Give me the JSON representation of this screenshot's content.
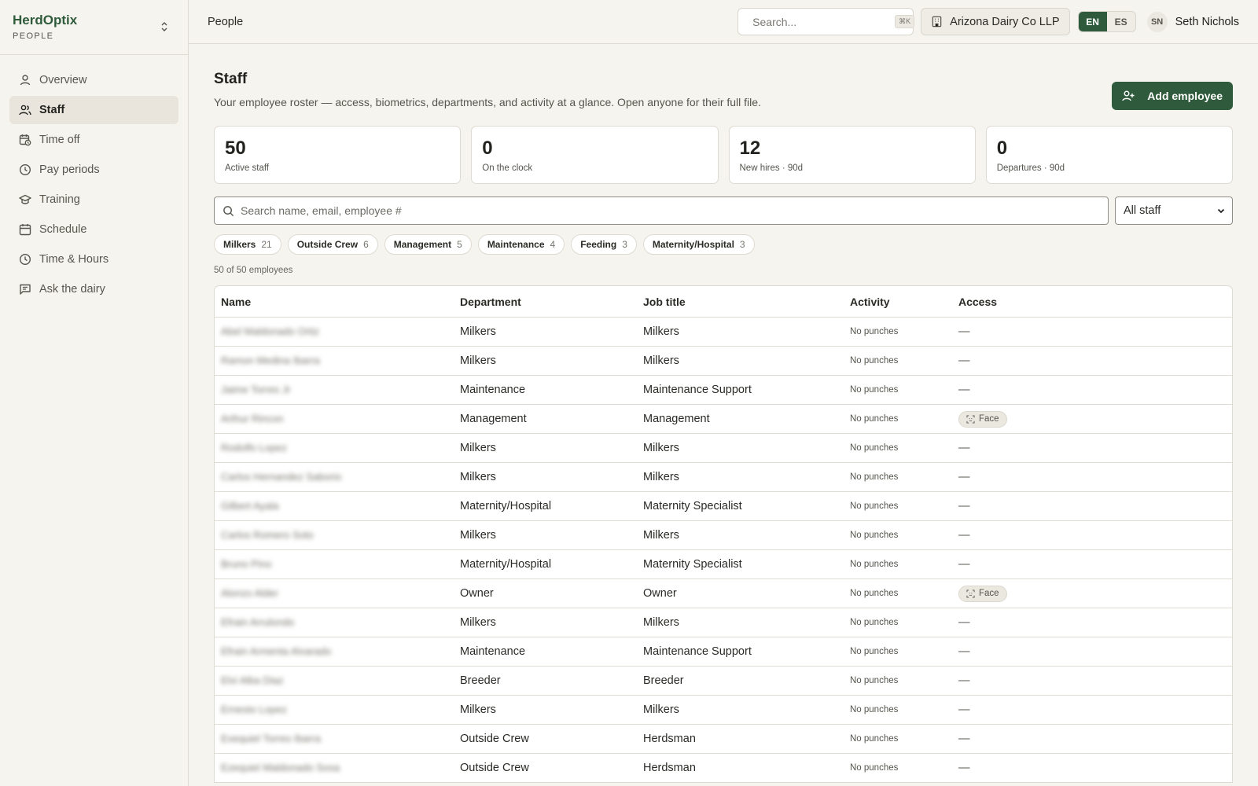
{
  "brand": {
    "name": "HerdOptix",
    "section": "PEOPLE"
  },
  "nav": [
    {
      "label": "Overview",
      "icon": "user-icon"
    },
    {
      "label": "Staff",
      "icon": "users-icon",
      "active": true
    },
    {
      "label": "Time off",
      "icon": "calendar-clock-icon"
    },
    {
      "label": "Pay periods",
      "icon": "clock-icon"
    },
    {
      "label": "Training",
      "icon": "graduation-cap-icon"
    },
    {
      "label": "Schedule",
      "icon": "calendar-icon"
    },
    {
      "label": "Time & Hours",
      "icon": "clock-icon"
    },
    {
      "label": "Ask the dairy",
      "icon": "message-icon"
    }
  ],
  "topbar": {
    "breadcrumb": "People",
    "search_placeholder": "Search...",
    "search_shortcut": "⌘K",
    "org_name": "Arizona Dairy Co LLP",
    "lang_en": "EN",
    "lang_es": "ES",
    "user_initials": "SN",
    "user_name": "Seth Nichols"
  },
  "page": {
    "title": "Staff",
    "subtitle": "Your employee roster — access, biometrics, departments, and activity at a glance. Open anyone for their full file.",
    "add_button": "Add employee"
  },
  "stats": [
    {
      "value": "50",
      "label": "Active staff"
    },
    {
      "value": "0",
      "label": "On the clock"
    },
    {
      "value": "12",
      "label": "New hires · 90d"
    },
    {
      "value": "0",
      "label": "Departures · 90d"
    }
  ],
  "filters": {
    "search_placeholder": "Search name, email, employee #",
    "select_value": "All staff"
  },
  "chips": [
    {
      "label": "Milkers",
      "count": "21"
    },
    {
      "label": "Outside Crew",
      "count": "6"
    },
    {
      "label": "Management",
      "count": "5"
    },
    {
      "label": "Maintenance",
      "count": "4"
    },
    {
      "label": "Feeding",
      "count": "3"
    },
    {
      "label": "Maternity/Hospital",
      "count": "3"
    }
  ],
  "result_count": "50 of 50 employees",
  "table": {
    "headers": {
      "name": "Name",
      "department": "Department",
      "job_title": "Job title",
      "activity": "Activity",
      "access": "Access"
    },
    "rows": [
      {
        "name": "Abel Maldonado Ortiz",
        "department": "Milkers",
        "job_title": "Milkers",
        "activity": "No punches",
        "access": "—"
      },
      {
        "name": "Ramon Medina Ibarra",
        "department": "Milkers",
        "job_title": "Milkers",
        "activity": "No punches",
        "access": "—"
      },
      {
        "name": "Jaime Torres Jr",
        "department": "Maintenance",
        "job_title": "Maintenance Support",
        "activity": "No punches",
        "access": "—"
      },
      {
        "name": "Arthur Rincon",
        "department": "Management",
        "job_title": "Management",
        "activity": "No punches",
        "access": "Face"
      },
      {
        "name": "Rodolfo Lopez",
        "department": "Milkers",
        "job_title": "Milkers",
        "activity": "No punches",
        "access": "—"
      },
      {
        "name": "Carlos Hernandez Saborio",
        "department": "Milkers",
        "job_title": "Milkers",
        "activity": "No punches",
        "access": "—"
      },
      {
        "name": "Gilbert Ayala",
        "department": "Maternity/Hospital",
        "job_title": "Maternity Specialist",
        "activity": "No punches",
        "access": "—"
      },
      {
        "name": "Carlos Romero Soto",
        "department": "Milkers",
        "job_title": "Milkers",
        "activity": "No punches",
        "access": "—"
      },
      {
        "name": "Bruno Pino",
        "department": "Maternity/Hospital",
        "job_title": "Maternity Specialist",
        "activity": "No punches",
        "access": "—"
      },
      {
        "name": "Alonzo Alder",
        "department": "Owner",
        "job_title": "Owner",
        "activity": "No punches",
        "access": "Face"
      },
      {
        "name": "Efrain Arrulondo",
        "department": "Milkers",
        "job_title": "Milkers",
        "activity": "No punches",
        "access": "—"
      },
      {
        "name": "Efrain Armenta Alvarado",
        "department": "Maintenance",
        "job_title": "Maintenance Support",
        "activity": "No punches",
        "access": "—"
      },
      {
        "name": "Elvi Alba Diaz",
        "department": "Breeder",
        "job_title": "Breeder",
        "activity": "No punches",
        "access": "—"
      },
      {
        "name": "Ernesto Lopez",
        "department": "Milkers",
        "job_title": "Milkers",
        "activity": "No punches",
        "access": "—"
      },
      {
        "name": "Exequiel Torres Ibarra",
        "department": "Outside Crew",
        "job_title": "Herdsman",
        "activity": "No punches",
        "access": "—"
      },
      {
        "name": "Ezequiel Maldonado Sosa",
        "department": "Outside Crew",
        "job_title": "Herdsman",
        "activity": "No punches",
        "access": "—"
      }
    ]
  }
}
